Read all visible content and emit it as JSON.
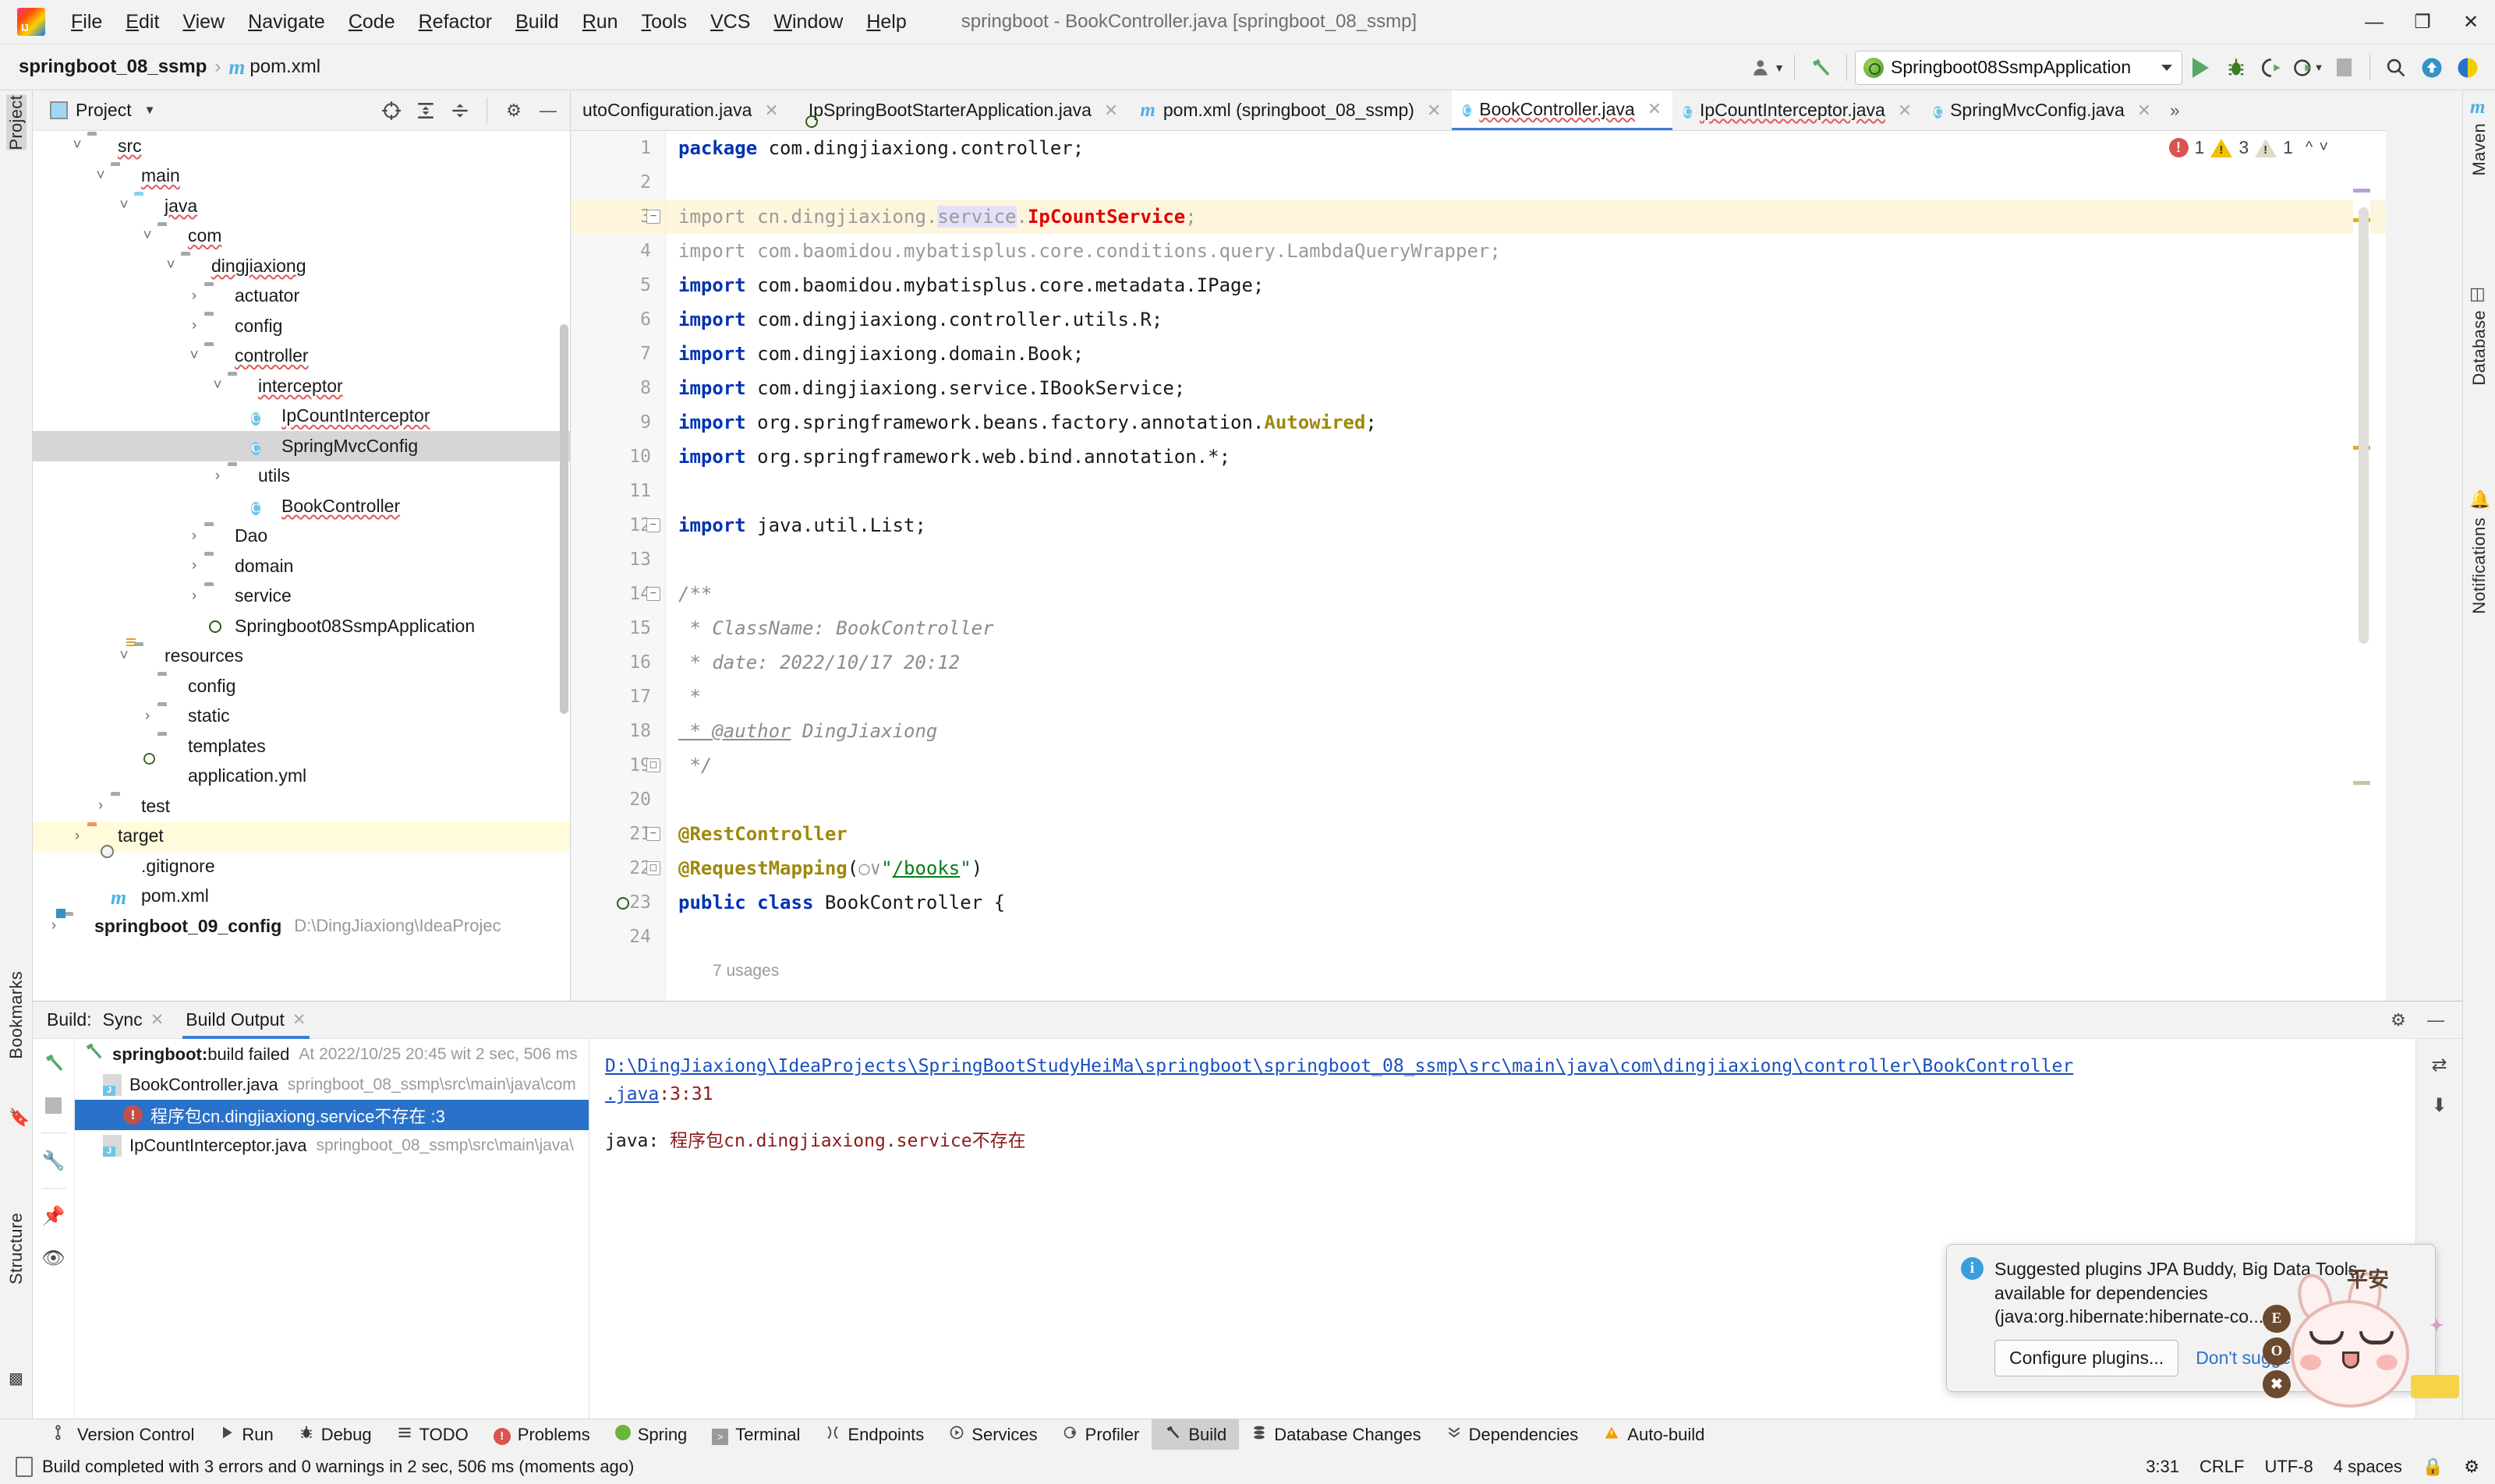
{
  "titlebar": {
    "window_title": "springboot - BookController.java [springboot_08_ssmp]",
    "menus": [
      "File",
      "Edit",
      "View",
      "Navigate",
      "Code",
      "Refactor",
      "Build",
      "Run",
      "Tools",
      "VCS",
      "Window",
      "Help"
    ],
    "minimize": "—",
    "maximize": "❐",
    "close": "✕"
  },
  "navbar": {
    "project_name": "springboot_08_ssmp",
    "separator": "›",
    "file_name": "pom.xml",
    "run_config": "Springboot08SsmpApplication",
    "icons": {
      "user": "user-icon",
      "build_hammer": "hammer-icon",
      "run": "run-icon",
      "debug": "debug-icon",
      "run_coverage": "run-with-coverage-icon",
      "profile": "profile-icon",
      "stop": "stop-icon",
      "search": "search-everywhere-icon",
      "update": "update-project-icon",
      "settings": "ide-settings-icon"
    }
  },
  "left_strip": {
    "items": [
      "Project",
      "Bookmarks",
      "Structure"
    ]
  },
  "right_strip": {
    "items": [
      "Maven",
      "Database",
      "Notifications"
    ]
  },
  "project_panel": {
    "title": "Project",
    "toolbar_icons": [
      "locate-icon",
      "expand-all-icon",
      "collapse-all-icon",
      "gear-icon",
      "hide-icon"
    ],
    "tree": [
      {
        "label": "src",
        "indent": 1,
        "arrow": "down",
        "icon": "folder",
        "squiggle": true
      },
      {
        "label": "main",
        "indent": 2,
        "arrow": "down",
        "icon": "folder",
        "squiggle": true
      },
      {
        "label": "java",
        "indent": 3,
        "arrow": "down",
        "icon": "folder-source",
        "squiggle": true
      },
      {
        "label": "com",
        "indent": 4,
        "arrow": "down",
        "icon": "folder-pkg",
        "squiggle": true
      },
      {
        "label": "dingjiaxiong",
        "indent": 5,
        "arrow": "down",
        "icon": "folder-pkg",
        "squiggle": true
      },
      {
        "label": "actuator",
        "indent": 6,
        "arrow": "right",
        "icon": "folder-pkg",
        "squiggle": false
      },
      {
        "label": "config",
        "indent": 6,
        "arrow": "right",
        "icon": "folder-pkg",
        "squiggle": false
      },
      {
        "label": "controller",
        "indent": 6,
        "arrow": "down",
        "icon": "folder-pkg",
        "squiggle": true
      },
      {
        "label": "interceptor",
        "indent": 7,
        "arrow": "down",
        "icon": "folder-pkg",
        "squiggle": true
      },
      {
        "label": "IpCountInterceptor",
        "indent": 8,
        "arrow": "none",
        "icon": "class",
        "squiggle": true
      },
      {
        "label": "SpringMvcConfig",
        "indent": 8,
        "arrow": "none",
        "icon": "class",
        "squiggle": false,
        "selected": true
      },
      {
        "label": "utils",
        "indent": 7,
        "arrow": "right",
        "icon": "folder-pkg",
        "squiggle": false
      },
      {
        "label": "BookController",
        "indent": 8,
        "arrow": "none",
        "icon": "class",
        "squiggle": true
      },
      {
        "label": "Dao",
        "indent": 6,
        "arrow": "right",
        "icon": "folder-pkg",
        "squiggle": false
      },
      {
        "label": "domain",
        "indent": 6,
        "arrow": "right",
        "icon": "folder-pkg",
        "squiggle": false
      },
      {
        "label": "service",
        "indent": 6,
        "arrow": "right",
        "icon": "folder-pkg",
        "squiggle": false
      },
      {
        "label": "Springboot08SsmpApplication",
        "indent": 6,
        "arrow": "none",
        "icon": "spring-run",
        "squiggle": false
      },
      {
        "label": "resources",
        "indent": 3,
        "arrow": "down",
        "icon": "folder-res",
        "squiggle": false
      },
      {
        "label": "config",
        "indent": 4,
        "arrow": "none",
        "icon": "folder",
        "squiggle": false
      },
      {
        "label": "static",
        "indent": 4,
        "arrow": "right",
        "icon": "folder",
        "squiggle": false
      },
      {
        "label": "templates",
        "indent": 4,
        "arrow": "none",
        "icon": "folder",
        "squiggle": false
      },
      {
        "label": "application.yml",
        "indent": 4,
        "arrow": "none",
        "icon": "spring-yml",
        "squiggle": false
      },
      {
        "label": "test",
        "indent": 2,
        "arrow": "right",
        "icon": "folder",
        "squiggle": false
      },
      {
        "label": "target",
        "indent": 1,
        "arrow": "right",
        "icon": "folder-target",
        "squiggle": false,
        "highlight": true
      },
      {
        "label": ".gitignore",
        "indent": 2,
        "arrow": "none",
        "icon": "gitignore",
        "squiggle": false
      },
      {
        "label": "pom.xml",
        "indent": 2,
        "arrow": "none",
        "icon": "maven",
        "squiggle": false
      },
      {
        "label": "springboot_09_config",
        "indent": 0,
        "arrow": "right",
        "icon": "module",
        "squiggle": false,
        "bold": true,
        "path": "D:\\DingJiaxiong\\IdeaProjec"
      }
    ]
  },
  "editor": {
    "tabs": [
      {
        "label": "utoConfiguration.java",
        "icon": "none",
        "active": false,
        "wavy": false,
        "clipped": true
      },
      {
        "label": "IpSpringBootStarterApplication.java",
        "icon": "spring",
        "active": false,
        "wavy": false
      },
      {
        "label": "pom.xml (springboot_08_ssmp)",
        "icon": "maven",
        "active": false,
        "wavy": false
      },
      {
        "label": "BookController.java",
        "icon": "class",
        "active": true,
        "wavy": true
      },
      {
        "label": "IpCountInterceptor.java",
        "icon": "class",
        "active": false,
        "wavy": true
      },
      {
        "label": "SpringMvcConfig.java",
        "icon": "class",
        "active": false,
        "wavy": false
      }
    ],
    "tab_overflow": "»",
    "inspection": {
      "errors": "1",
      "warnings": "3",
      "weak_warnings": "1"
    },
    "usages_hint": "7 usages",
    "lines": [
      {
        "n": "1",
        "tokens": [
          {
            "t": "package ",
            "c": "kw"
          },
          {
            "t": "com.dingjiaxiong.controller;",
            "c": ""
          }
        ]
      },
      {
        "n": "2",
        "tokens": []
      },
      {
        "n": "3",
        "highlight": true,
        "fold": "minus",
        "tokens": [
          {
            "t": "import ",
            "c": "dim"
          },
          {
            "t": "cn.dingjiaxiong.",
            "c": "dim"
          },
          {
            "t": "service",
            "c": "sel-tok dim"
          },
          {
            "t": ".",
            "c": "dim"
          },
          {
            "t": "IpCountService",
            "c": "err"
          },
          {
            "t": ";",
            "c": "dim"
          }
        ]
      },
      {
        "n": "4",
        "tokens": [
          {
            "t": "import com.baomidou.mybatisplus.core.conditions.query.LambdaQueryWrapper;",
            "c": "dim"
          }
        ]
      },
      {
        "n": "5",
        "tokens": [
          {
            "t": "import ",
            "c": "kw"
          },
          {
            "t": "com.baomidou.mybatisplus.core.metadata.IPage;",
            "c": ""
          }
        ]
      },
      {
        "n": "6",
        "tokens": [
          {
            "t": "import ",
            "c": "kw"
          },
          {
            "t": "com.dingjiaxiong.controller.utils.R;",
            "c": ""
          }
        ]
      },
      {
        "n": "7",
        "tokens": [
          {
            "t": "import ",
            "c": "kw"
          },
          {
            "t": "com.dingjiaxiong.domain.Book;",
            "c": ""
          }
        ]
      },
      {
        "n": "8",
        "tokens": [
          {
            "t": "import ",
            "c": "kw"
          },
          {
            "t": "com.dingjiaxiong.service.IBookService;",
            "c": ""
          }
        ]
      },
      {
        "n": "9",
        "tokens": [
          {
            "t": "import ",
            "c": "kw"
          },
          {
            "t": "org.springframework.beans.factory.annotation.",
            "c": ""
          },
          {
            "t": "Autowired",
            "c": "ann"
          },
          {
            "t": ";",
            "c": ""
          }
        ]
      },
      {
        "n": "10",
        "tokens": [
          {
            "t": "import ",
            "c": "kw"
          },
          {
            "t": "org.springframework.web.bind.annotation.*;",
            "c": ""
          }
        ]
      },
      {
        "n": "11",
        "tokens": []
      },
      {
        "n": "12",
        "fold": "minus",
        "tokens": [
          {
            "t": "import ",
            "c": "kw"
          },
          {
            "t": "java.util.List;",
            "c": ""
          }
        ]
      },
      {
        "n": "13",
        "tokens": []
      },
      {
        "n": "14",
        "fold": "minus",
        "tokens": [
          {
            "t": "/**",
            "c": "cmt"
          }
        ]
      },
      {
        "n": "15",
        "tokens": [
          {
            "t": " * ClassName: BookController",
            "c": "cmt"
          }
        ]
      },
      {
        "n": "16",
        "tokens": [
          {
            "t": " * date: 2022/10/17 20:12",
            "c": "cmt"
          }
        ]
      },
      {
        "n": "17",
        "tokens": [
          {
            "t": " *",
            "c": "cmt"
          }
        ]
      },
      {
        "n": "18",
        "tokens": [
          {
            "t": " * @author",
            "c": "cmt u"
          },
          {
            "t": " DingJiaxiong",
            "c": "cmt"
          }
        ]
      },
      {
        "n": "19",
        "fold": "end",
        "tokens": [
          {
            "t": " */",
            "c": "cmt"
          }
        ]
      },
      {
        "n": "20",
        "tokens": []
      },
      {
        "n": "21",
        "fold": "minus",
        "tokens": [
          {
            "t": "@RestController",
            "c": "ann"
          }
        ]
      },
      {
        "n": "22",
        "fold": "end",
        "tokens": [
          {
            "t": "@RequestMapping",
            "c": "ann"
          },
          {
            "t": "(",
            "c": ""
          },
          {
            "t": "○∨",
            "c": "dim"
          },
          {
            "t": "\"",
            "c": "str"
          },
          {
            "t": "/books",
            "c": "str u"
          },
          {
            "t": "\"",
            "c": "str"
          },
          {
            "t": ")",
            "c": ""
          }
        ]
      },
      {
        "n": "23",
        "gutter_icon": "spring-bean",
        "tokens": [
          {
            "t": "public ",
            "c": "kw"
          },
          {
            "t": "class ",
            "c": "kw"
          },
          {
            "t": "BookController {",
            "c": ""
          }
        ]
      },
      {
        "n": "24",
        "tokens": []
      }
    ]
  },
  "build_panel": {
    "label": "Build:",
    "tabs": [
      {
        "label": "Sync",
        "active": false
      },
      {
        "label": "Build Output",
        "active": true
      }
    ],
    "side_icons": [
      "hammer-icon",
      "stop-icon",
      "wrench-icon",
      "pin-icon",
      "eye-icon"
    ],
    "right_icons": [
      "gear-icon",
      "hide-icon",
      "wrap-icon",
      "download-icon"
    ],
    "tree": [
      {
        "icon": "hammer",
        "bold": "springboot:",
        "main": " build failed",
        "sub": "At 2022/10/25 20:45 wit 2 sec, 506 ms",
        "indent": 0
      },
      {
        "icon": "java-file",
        "main": "BookController.java",
        "sub": "springboot_08_ssmp\\src\\main\\java\\com",
        "indent": 1
      },
      {
        "icon": "error",
        "main": "程序包cn.dingjiaxiong.service不存在 :3",
        "sub": "",
        "indent": 2,
        "selected": true
      },
      {
        "icon": "java-file",
        "main": "IpCountInterceptor.java",
        "sub": "springboot_08_ssmp\\src\\main\\java\\",
        "indent": 1
      }
    ],
    "detail": {
      "link_path": "D:\\DingJiaxiong\\IdeaProjects\\SpringBootStudyHeiMa\\springboot\\springboot_08_ssmp\\src\\main\\java\\com\\dingjiaxiong\\controller\\BookController",
      "link_suffix": ".java",
      "link_pos": ":3:31",
      "message_prefix": "java: ",
      "message_body": "程序包cn.dingjiaxiong.service不存在"
    }
  },
  "notification": {
    "title_line1": "Suggested plugins JPA Buddy, Big Data Tools",
    "title_line2": "available for dependencies",
    "title_line3": "(java:org.hibernate:hibernate-co...",
    "primary_button": "Configure plugins...",
    "secondary_link": "Don't suggest"
  },
  "bottom_bar": {
    "items": [
      {
        "label": "Version Control",
        "icon": "branch-icon",
        "active": false
      },
      {
        "label": "Run",
        "icon": "run-icon",
        "active": false
      },
      {
        "label": "Debug",
        "icon": "debug-icon",
        "active": false
      },
      {
        "label": "TODO",
        "icon": "list-icon",
        "active": false
      },
      {
        "label": "Problems",
        "icon": "error-icon",
        "active": false
      },
      {
        "label": "Spring",
        "icon": "spring-icon",
        "active": false
      },
      {
        "label": "Terminal",
        "icon": "terminal-icon",
        "active": false
      },
      {
        "label": "Endpoints",
        "icon": "endpoints-icon",
        "active": false
      },
      {
        "label": "Services",
        "icon": "services-icon",
        "active": false
      },
      {
        "label": "Profiler",
        "icon": "profiler-icon",
        "active": false
      },
      {
        "label": "Build",
        "icon": "hammer-icon",
        "active": true
      },
      {
        "label": "Database Changes",
        "icon": "db-icon",
        "active": false
      },
      {
        "label": "Dependencies",
        "icon": "deps-icon",
        "active": false
      },
      {
        "label": "Auto-build",
        "icon": "warning-icon",
        "active": false
      }
    ]
  },
  "status_bar": {
    "message": "Build completed with 3 errors and 0 warnings in 2 sec, 506 ms (moments ago)",
    "caret": "3:31",
    "line_sep": "CRLF",
    "encoding": "UTF-8",
    "indent": "4 spaces"
  }
}
